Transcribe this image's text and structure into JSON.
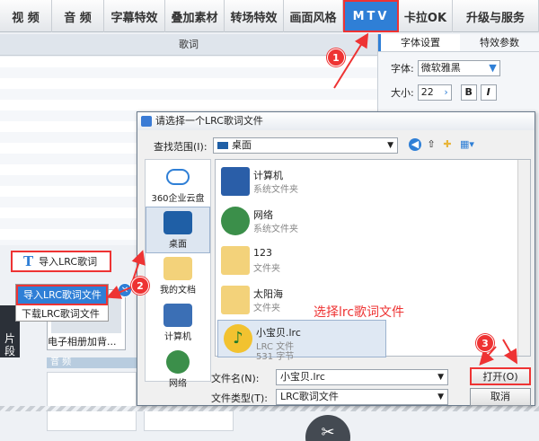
{
  "tabs": [
    "视 频",
    "音 频",
    "字幕特效",
    "叠加素材",
    "转场特效",
    "画面风格",
    "MTV",
    "卡拉OK",
    "升级与服务"
  ],
  "active_tab": "MTV",
  "lyrics_header": "歌词",
  "font_panel": {
    "tab_font": "字体设置",
    "tab_effect": "特效参数",
    "font_label": "字体:",
    "font_value": "微软雅黑",
    "size_label": "大小:",
    "size_value": "22",
    "bold": "B",
    "italic": "I"
  },
  "import_button": {
    "icon": "T",
    "label": "导入LRC歌词"
  },
  "dropdown": {
    "import_file": "导入LRC歌词文件",
    "download_file": "下载LRC歌词文件"
  },
  "side_label": "片段",
  "thumb_caption": "电子相册加背...",
  "audio_track": "音 频",
  "dialog": {
    "title": "请选择一个LRC歌词文件",
    "lookin_label": "查找范围(I):",
    "lookin_value": "桌面",
    "places": [
      {
        "name": "360企业云盘"
      },
      {
        "name": "桌面"
      },
      {
        "name": "我的文档"
      },
      {
        "name": "计算机"
      },
      {
        "name": "网络"
      }
    ],
    "files": [
      {
        "name": "计算机",
        "type": "系统文件夹"
      },
      {
        "name": "网络",
        "type": "系统文件夹"
      },
      {
        "name": "123",
        "type": "文件夹"
      },
      {
        "name": "太阳海",
        "type": "文件夹"
      },
      {
        "name": "小宝贝.lrc",
        "type": "LRC 文件",
        "size": "531 字节"
      }
    ],
    "annotation": "选择lrc歌词文件",
    "filename_label": "文件名(N):",
    "filename_value": "小宝贝.lrc",
    "filetype_label": "文件类型(T):",
    "filetype_value": "LRC歌词文件",
    "open_button": "打开(O)",
    "cancel_button": "取消"
  },
  "steps": [
    "1",
    "2",
    "3"
  ],
  "colors": {
    "accent": "#2f7fd6",
    "annotation_red": "#e33333"
  }
}
